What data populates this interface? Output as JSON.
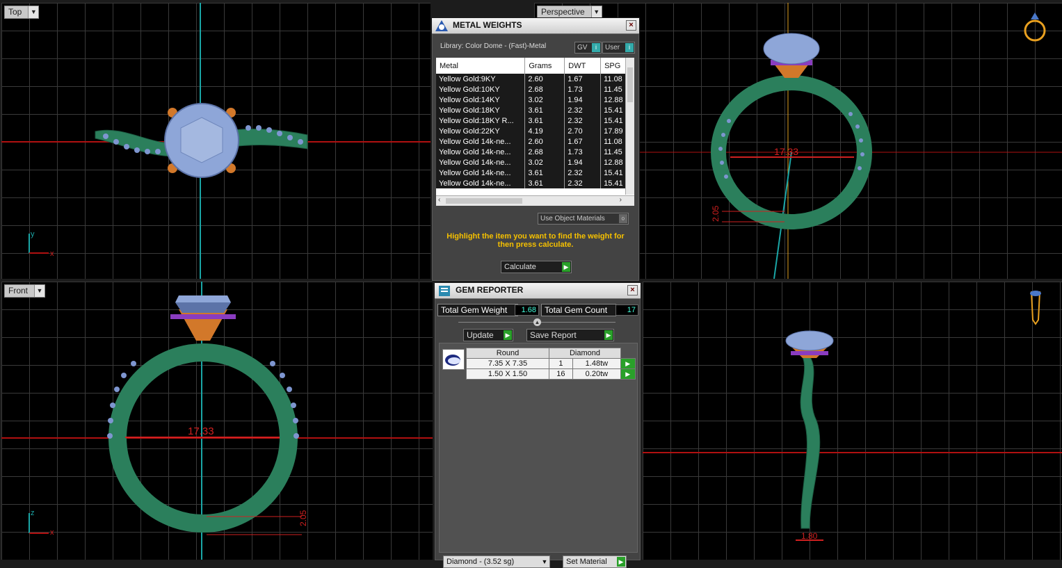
{
  "viewports": {
    "top": {
      "label": "Top",
      "axis_a": "y",
      "axis_b": "x"
    },
    "perspective": {
      "label": "Perspective",
      "dim_ring": "17.33",
      "dim_height": "2.05"
    },
    "front": {
      "label": "Front",
      "dim_ring": "17.33",
      "dim_height": "2.05",
      "axis_a": "z",
      "axis_b": "x"
    },
    "right": {
      "dim_width": "1.80"
    }
  },
  "metal_weights": {
    "title": "METAL WEIGHTS",
    "library": "Library: Color Dome - (Fast)-Metal",
    "gv_label": "GV",
    "user_label": "User",
    "columns": [
      "Metal",
      "Grams",
      "DWT",
      "SPG"
    ],
    "rows": [
      [
        "Yellow Gold:9KY",
        "2.60",
        "1.67",
        "11.08"
      ],
      [
        "Yellow Gold:10KY",
        "2.68",
        "1.73",
        "11.45"
      ],
      [
        "Yellow Gold:14KY",
        "3.02",
        "1.94",
        "12.88"
      ],
      [
        "Yellow Gold:18KY",
        "3.61",
        "2.32",
        "15.41"
      ],
      [
        "Yellow Gold:18KY R...",
        "3.61",
        "2.32",
        "15.41"
      ],
      [
        "Yellow Gold:22KY",
        "4.19",
        "2.70",
        "17.89"
      ],
      [
        "Yellow Gold 14k-ne...",
        "2.60",
        "1.67",
        "11.08"
      ],
      [
        "Yellow Gold 14k-ne...",
        "2.68",
        "1.73",
        "11.45"
      ],
      [
        "Yellow Gold 14k-ne...",
        "3.02",
        "1.94",
        "12.88"
      ],
      [
        "Yellow Gold 14k-ne...",
        "3.61",
        "2.32",
        "15.41"
      ],
      [
        "Yellow Gold 14k-ne...",
        "3.61",
        "2.32",
        "15.41"
      ]
    ],
    "use_object_materials": "Use Object Materials",
    "instruction": "Highlight the item you want to find the weight for then press calculate.",
    "calculate": "Calculate"
  },
  "gem_reporter": {
    "title": "GEM REPORTER",
    "total_weight_label": "Total Gem Weight",
    "total_weight_value": "1.68",
    "total_count_label": "Total Gem Count",
    "total_count_value": "17",
    "update": "Update",
    "save_report": "Save Report",
    "shape_header": "Round",
    "stone_header": "Diamond",
    "gems": [
      {
        "size": "7.35 X 7.35",
        "count": "1",
        "weight": "1.48tw"
      },
      {
        "size": "1.50 X 1.50",
        "count": "16",
        "weight": "0.20tw"
      }
    ],
    "bottom_select": "Diamond - (3.52 sg)",
    "bottom_button": "Set Material"
  }
}
